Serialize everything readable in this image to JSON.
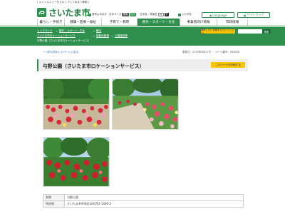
{
  "header": {
    "skip_link": "( メインメニューをスキップして本文へ移動 )",
    "site_name": "さいたま市",
    "utilities": {
      "voice": "音声よみあげ",
      "font_size_label": "文字サイズ",
      "font_size_small": "標準",
      "font_size_large": "拡大",
      "color_label": "文字色・背景色",
      "color_white": "白",
      "color_black": "黒",
      "subtitles": "ふりがな",
      "language": "Language",
      "sitemap": "サイトマップ"
    },
    "colors": {
      "brand_green": "#2f8f4e",
      "accent_yellow": "#f8c300"
    }
  },
  "gnav": [
    {
      "label": "暮らし・手続き"
    },
    {
      "label": "健康・医療・福祉"
    },
    {
      "label": "子育て・教育"
    },
    {
      "label": "観光・スポーツ・文化"
    },
    {
      "label": "事業者向け情報"
    },
    {
      "label": "市政情報"
    }
  ],
  "breadcrumb": {
    "row1": [
      "トップページ",
      "観光・スポーツ・文化",
      "観光"
    ],
    "row2": [
      "さいたま市ロケーションサービス",
      "撮影地候補",
      "公園施設等"
    ],
    "current": "与野公園（さいたま市ロケーションサービス）"
  },
  "header_actions": {
    "orange_button": "検索したい言葉を入力してください",
    "search_button": "検索"
  },
  "subinfo": {
    "back_link": "一つ前の見出しのページに戻る",
    "updated": "更新日：2019年6月17日 ｜ ページ番号：064638"
  },
  "page": {
    "title": "与野公園（さいたま市ロケーションサービス）",
    "share_button": "このページを印刷する"
  },
  "info_table": [
    {
      "label": "名称",
      "value": "与野公園"
    },
    {
      "label": "所在地",
      "value": "さいたま市中央区本町西1-1400-2"
    }
  ]
}
